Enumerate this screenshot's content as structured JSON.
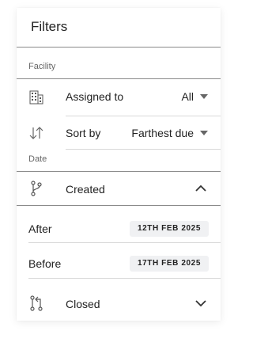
{
  "panel": {
    "title": "Filters"
  },
  "facility": {
    "section_label": "Facility",
    "assigned_to": {
      "icon": "building-icon",
      "label": "Assigned to",
      "value": "All"
    },
    "sort_by": {
      "icon": "sort-arrows-icon",
      "label": "Sort by",
      "value": "Farthest due"
    }
  },
  "date": {
    "section_label": "Date",
    "created": {
      "icon": "branch-icon",
      "label": "Created",
      "expanded": true,
      "after_label": "After",
      "after_value": "12TH FEB 2025",
      "before_label": "Before",
      "before_value": "17TH FEB 2025"
    },
    "closed": {
      "icon": "pull-request-icon",
      "label": "Closed",
      "expanded": false
    }
  },
  "colors": {
    "text": "#222222",
    "muted": "#666666",
    "divider": "#d8d8d8",
    "chip_bg": "#f0f1f3"
  }
}
